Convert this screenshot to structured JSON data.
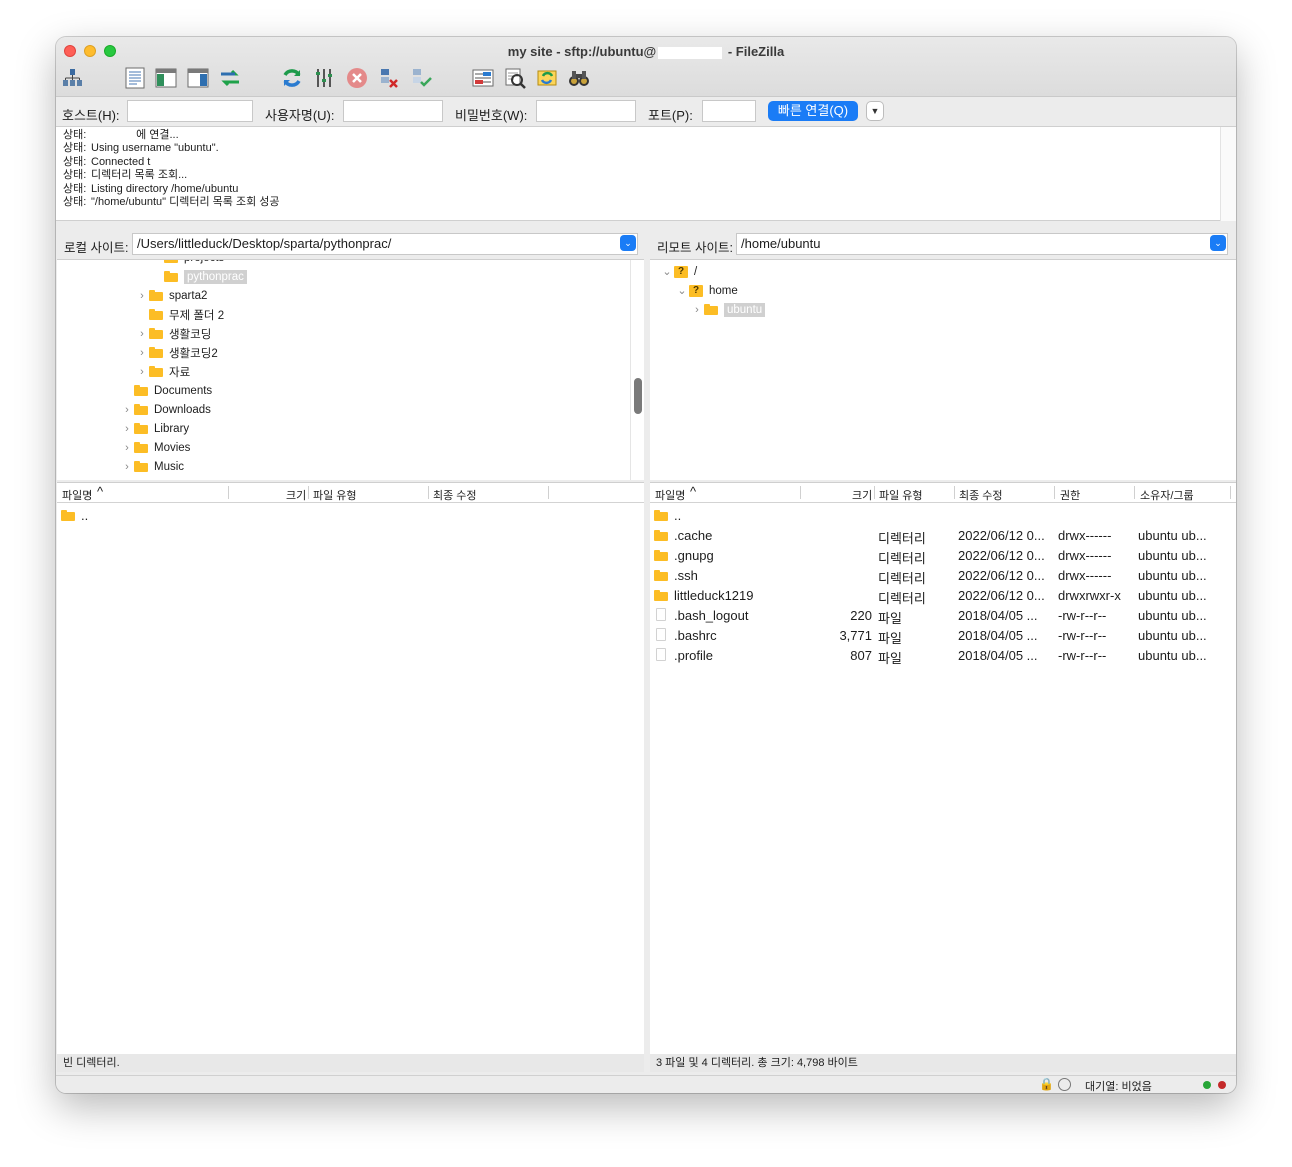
{
  "window": {
    "title_prefix": "my site - sftp://ubuntu@",
    "title_suffix": " - FileZilla"
  },
  "toolbar": {
    "icons": [
      "site-manager-icon",
      "toggle-log-icon",
      "toggle-local-tree-icon",
      "toggle-remote-tree-icon",
      "transfer-queue-icon",
      "refresh-icon",
      "process-queue-icon",
      "cancel-icon",
      "disconnect-icon",
      "reconnect-icon",
      "filter-icon",
      "compare-icon",
      "sync-browse-icon",
      "search-icon"
    ]
  },
  "quickconnect": {
    "host_label": "호스트(H):",
    "user_label": "사용자명(U):",
    "pass_label": "비밀번호(W):",
    "port_label": "포트(P):",
    "connect_label": "빠른 연결(Q)",
    "host_value": "",
    "user_value": "",
    "pass_value": "",
    "port_value": ""
  },
  "log": [
    {
      "k": "상태:",
      "v": "에 연결...",
      "masked": true
    },
    {
      "k": "상태:",
      "v": "Using username \"ubuntu\"."
    },
    {
      "k": "상태:",
      "v": "Connected t"
    },
    {
      "k": "상태:",
      "v": "디렉터리 목록 조회..."
    },
    {
      "k": "상태:",
      "v": "Listing directory /home/ubuntu"
    },
    {
      "k": "상태:",
      "v": "\"/home/ubuntu\" 디렉터리 목록 조회 성공"
    }
  ],
  "local": {
    "site_label": "로컬 사이트:",
    "path": "/Users/littleduck/Desktop/sparta/pythonprac/",
    "tree": [
      {
        "name": "projects",
        "chev": "›",
        "depth": 3
      },
      {
        "name": "pythonprac",
        "chev": "",
        "depth": 3,
        "selected": true
      },
      {
        "name": "sparta2",
        "chev": "›",
        "depth": 2
      },
      {
        "name": "무제 폴더 2",
        "chev": "",
        "depth": 2
      },
      {
        "name": "생활코딩",
        "chev": "›",
        "depth": 2
      },
      {
        "name": "생활코딩2",
        "chev": "›",
        "depth": 2
      },
      {
        "name": "자료",
        "chev": "›",
        "depth": 2
      },
      {
        "name": "Documents",
        "chev": "",
        "depth": 1
      },
      {
        "name": "Downloads",
        "chev": "›",
        "depth": 1
      },
      {
        "name": "Library",
        "chev": "›",
        "depth": 1
      },
      {
        "name": "Movies",
        "chev": "›",
        "depth": 1
      },
      {
        "name": "Music",
        "chev": "›",
        "depth": 1
      }
    ],
    "columns": {
      "name": "파일명",
      "size": "크기",
      "type": "파일 유형",
      "modified": "최종 수정"
    },
    "files": [
      {
        "name": ".."
      }
    ],
    "status": "빈 디렉터리."
  },
  "remote": {
    "site_label": "리모트 사이트:",
    "path": "/home/ubuntu",
    "tree": [
      {
        "name": "/",
        "chev": "⌄",
        "depth": 0,
        "unknown": true
      },
      {
        "name": "home",
        "chev": "⌄",
        "depth": 1,
        "unknown": true
      },
      {
        "name": "ubuntu",
        "chev": "›",
        "depth": 2,
        "selected": true
      }
    ],
    "columns": {
      "name": "파일명",
      "size": "크기",
      "type": "파일 유형",
      "modified": "최종 수정",
      "perms": "권한",
      "owner": "소유자/그룹"
    },
    "files": [
      {
        "name": "..",
        "size": "",
        "type": "",
        "modified": "",
        "perms": "",
        "owner": "",
        "kind": "folder"
      },
      {
        "name": ".cache",
        "size": "",
        "type": "디렉터리",
        "modified": "2022/06/12 0...",
        "perms": "drwx------",
        "owner": "ubuntu ub...",
        "kind": "folder"
      },
      {
        "name": ".gnupg",
        "size": "",
        "type": "디렉터리",
        "modified": "2022/06/12 0...",
        "perms": "drwx------",
        "owner": "ubuntu ub...",
        "kind": "folder"
      },
      {
        "name": ".ssh",
        "size": "",
        "type": "디렉터리",
        "modified": "2022/06/12 0...",
        "perms": "drwx------",
        "owner": "ubuntu ub...",
        "kind": "folder"
      },
      {
        "name": "littleduck1219",
        "size": "",
        "type": "디렉터리",
        "modified": "2022/06/12 0...",
        "perms": "drwxrwxr-x",
        "owner": "ubuntu ub...",
        "kind": "folder"
      },
      {
        "name": ".bash_logout",
        "size": "220",
        "type": "파일",
        "modified": "2018/04/05 ...",
        "perms": "-rw-r--r--",
        "owner": "ubuntu ub...",
        "kind": "file"
      },
      {
        "name": ".bashrc",
        "size": "3,771",
        "type": "파일",
        "modified": "2018/04/05 ...",
        "perms": "-rw-r--r--",
        "owner": "ubuntu ub...",
        "kind": "file"
      },
      {
        "name": ".profile",
        "size": "807",
        "type": "파일",
        "modified": "2018/04/05 ...",
        "perms": "-rw-r--r--",
        "owner": "ubuntu ub...",
        "kind": "file"
      }
    ],
    "status": "3 파일 및 4 디렉터리. 총 크기: 4,798 바이트"
  },
  "statusbar": {
    "queue": "대기열: 비었음"
  }
}
